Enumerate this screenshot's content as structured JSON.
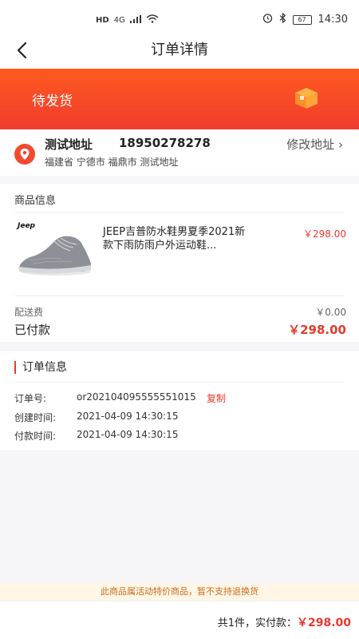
{
  "status_bar": {
    "hd": "HD",
    "network": "4G",
    "battery": "67",
    "time": "14:30"
  },
  "nav": {
    "title": "订单详情"
  },
  "order_status": {
    "label": "待发货"
  },
  "address": {
    "name": "测试地址",
    "phone": "18950278278",
    "edit_label": "修改地址 ›",
    "detail": "福建省 宁德市 福鼎市 测试地址"
  },
  "goods": {
    "section_title": "商品信息",
    "brand": "Jeep",
    "product_name": "JEEP吉普防水鞋男夏季2021新款下雨防雨户外运动鞋...",
    "product_price": "￥298.00",
    "shipping_label": "配送费",
    "shipping_value": "￥0.00",
    "paid_label": "已付款",
    "paid_value": "￥298.00"
  },
  "order_info": {
    "title": "订单信息",
    "order_no_label": "订单号:",
    "order_no_value": "or202104095555551015",
    "copy_label": "复制",
    "created_label": "创建时间:",
    "created_value": "2021-04-09 14:30:15",
    "paid_label": "付款时间:",
    "paid_value": "2021-04-09 14:30:15"
  },
  "notice": {
    "text": "此商品属活动特价商品，暂不支持退换货"
  },
  "bottom": {
    "summary_prefix": "共1件，实付款：",
    "amount": "￥298.00"
  },
  "colors": {
    "accent": "#e63a2e",
    "banner_top": "#ff5a1f",
    "banner_bottom": "#f13b2f",
    "notice_bg": "#fff6e6",
    "notice_text": "#c86a1e"
  },
  "icons": {
    "back": "chevron-left-icon",
    "location": "location-pin-icon",
    "package": "package-box-icon",
    "wifi": "wifi-icon",
    "signal": "signal-icon",
    "alarm": "alarm-icon",
    "bluetooth": "bluetooth-icon"
  }
}
